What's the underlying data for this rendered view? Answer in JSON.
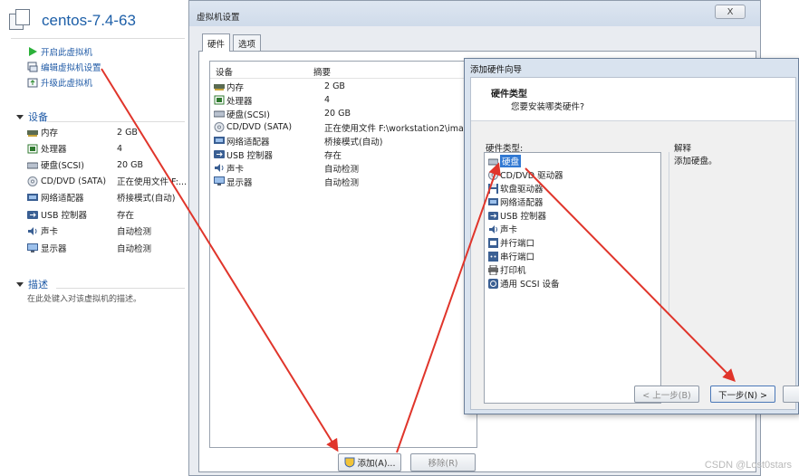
{
  "left_panel": {
    "vm_name": "centos-7.4-63",
    "actions": [
      {
        "label": "开启此虚拟机",
        "icon": "play-icon"
      },
      {
        "label": "编辑虚拟机设置",
        "icon": "edit-settings-icon"
      },
      {
        "label": "升级此虚拟机",
        "icon": "upgrade-icon"
      }
    ],
    "devices_heading": "设备",
    "devices": [
      {
        "name": "内存",
        "value": "2 GB",
        "icon": "memory-icon"
      },
      {
        "name": "处理器",
        "value": "4",
        "icon": "cpu-icon"
      },
      {
        "name": "硬盘(SCSI)",
        "value": "20 GB",
        "icon": "hard-disk-icon"
      },
      {
        "name": "CD/DVD (SATA)",
        "value": "正在使用文件 F:...",
        "icon": "cd-dvd-icon"
      },
      {
        "name": "网络适配器",
        "value": "桥接模式(自动)",
        "icon": "network-adapter-icon"
      },
      {
        "name": "USB 控制器",
        "value": "存在",
        "icon": "usb-controller-icon"
      },
      {
        "name": "声卡",
        "value": "自动检测",
        "icon": "sound-card-icon"
      },
      {
        "name": "显示器",
        "value": "自动检测",
        "icon": "display-icon"
      }
    ],
    "description_heading": "描述",
    "description_placeholder": "在此处键入对该虚拟机的描述。"
  },
  "settings_window": {
    "title": "虚拟机设置",
    "close_label": "X",
    "tabs": [
      {
        "label": "硬件"
      },
      {
        "label": "选项"
      }
    ],
    "columns": {
      "device": "设备",
      "summary": "摘要"
    },
    "devices": [
      {
        "name": "内存",
        "value": "2 GB",
        "icon": "memory-icon"
      },
      {
        "name": "处理器",
        "value": "4",
        "icon": "cpu-icon"
      },
      {
        "name": "硬盘(SCSI)",
        "value": "20 GB",
        "icon": "hard-disk-icon"
      },
      {
        "name": "CD/DVD (SATA)",
        "value": "正在使用文件 F:\\workstation2\\imag...",
        "icon": "cd-dvd-icon"
      },
      {
        "name": "网络适配器",
        "value": "桥接模式(自动)",
        "icon": "network-adapter-icon"
      },
      {
        "name": "USB 控制器",
        "value": "存在",
        "icon": "usb-controller-icon"
      },
      {
        "name": "声卡",
        "value": "自动检测",
        "icon": "sound-card-icon"
      },
      {
        "name": "显示器",
        "value": "自动检测",
        "icon": "display-icon"
      }
    ],
    "add_label": "添加(A)...",
    "remove_label": "移除(R)"
  },
  "wizard": {
    "title": "添加硬件向导",
    "heading": "硬件类型",
    "subheading": "您要安装哪类硬件?",
    "list_label": "硬件类型:",
    "hardware_types": [
      {
        "label": "硬盘",
        "icon": "hard-disk-icon",
        "selected": true
      },
      {
        "label": "CD/DVD 驱动器",
        "icon": "cd-dvd-icon"
      },
      {
        "label": "软盘驱动器",
        "icon": "floppy-icon"
      },
      {
        "label": "网络适配器",
        "icon": "network-adapter-icon"
      },
      {
        "label": "USB 控制器",
        "icon": "usb-controller-icon"
      },
      {
        "label": "声卡",
        "icon": "sound-card-icon"
      },
      {
        "label": "并行端口",
        "icon": "parallel-port-icon"
      },
      {
        "label": "串行端口",
        "icon": "serial-port-icon"
      },
      {
        "label": "打印机",
        "icon": "printer-icon"
      },
      {
        "label": "通用 SCSI 设备",
        "icon": "scsi-device-icon"
      }
    ],
    "explanation_label": "解释",
    "explanation_text": "添加硬盘。",
    "back_label": "< 上一步(B)",
    "next_label": "下一步(N) >"
  },
  "watermark": "CSDN @Lost0stars",
  "colors": {
    "link": "#1f5aa6",
    "selection": "#3179d3",
    "arrow": "#e0352b"
  }
}
